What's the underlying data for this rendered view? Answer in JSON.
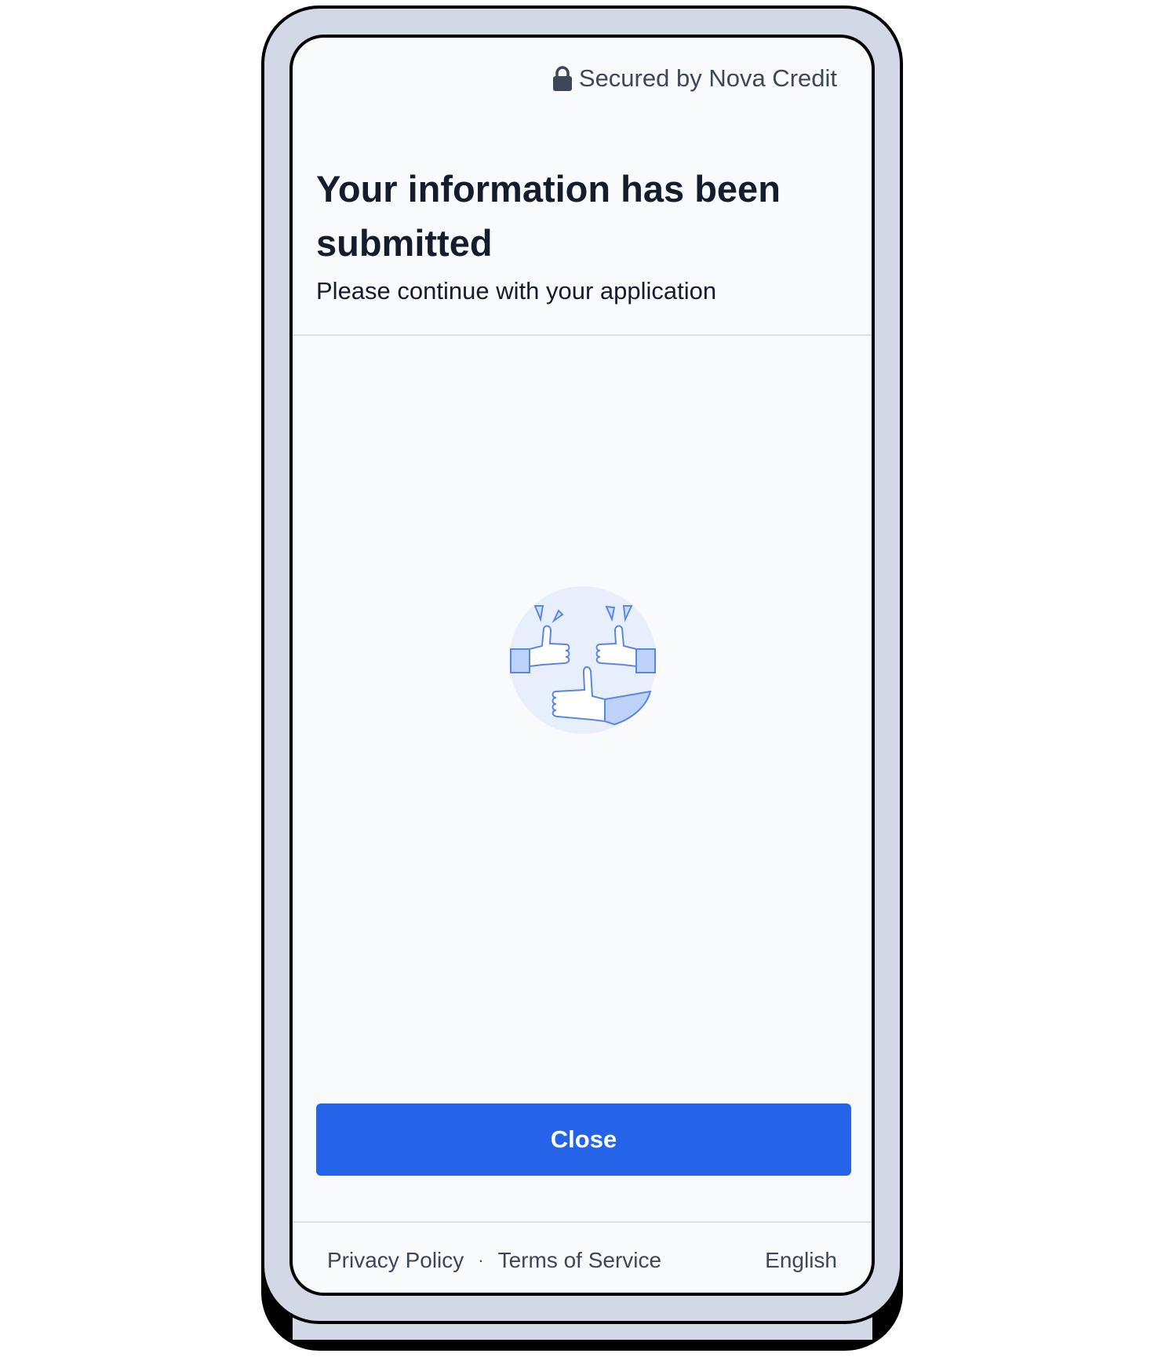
{
  "header": {
    "secured_label": "Secured by Nova Credit",
    "lock_icon": "lock-icon"
  },
  "main": {
    "title": "Your information has been submitted",
    "subtitle": "Please continue with your application",
    "illustration": "thumbs-up-illustration"
  },
  "actions": {
    "close_label": "Close"
  },
  "footer": {
    "privacy_label": "Privacy Policy",
    "separator": "·",
    "terms_label": "Terms of Service",
    "language_label": "English"
  },
  "colors": {
    "primary": "#2563e8",
    "text_dark": "#141c2e",
    "text_muted": "#3d4759",
    "frame": "#d2d8e6",
    "illustration_bg": "#e8effc",
    "illustration_accent": "#5b86e5"
  }
}
